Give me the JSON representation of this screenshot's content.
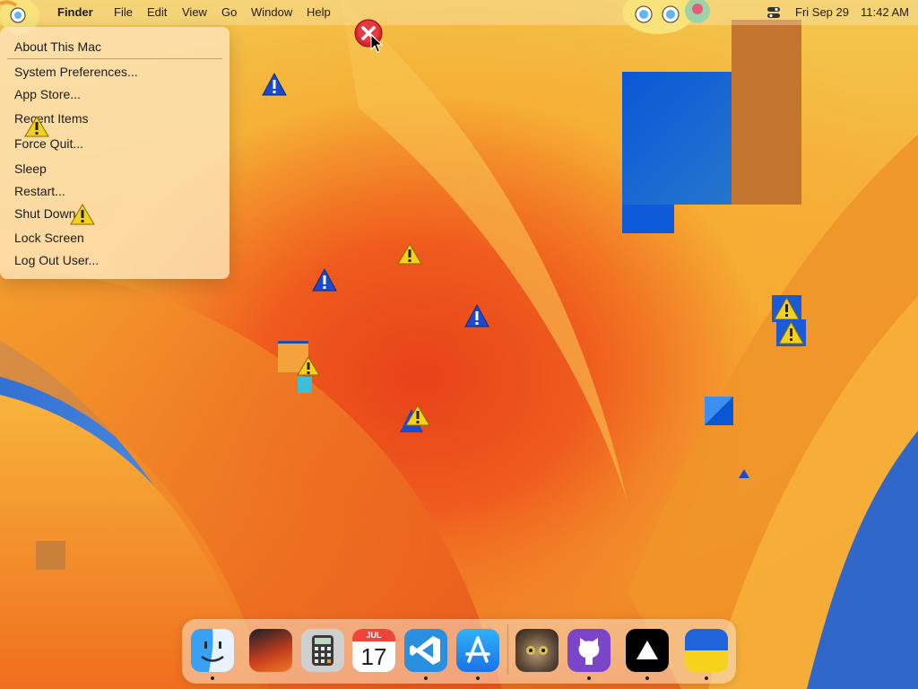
{
  "menubar": {
    "app_name": "Finder",
    "menus": [
      "File",
      "Edit",
      "View",
      "Go",
      "Window",
      "Help"
    ],
    "date": "Fri Sep 29",
    "time": "11:42 AM",
    "control_center_icon": "control-center-icon"
  },
  "apple_menu": {
    "items": [
      "About This Mac",
      "System Preferences...",
      "App Store...",
      "Recent Items",
      "Force Quit...",
      "Sleep",
      "Restart...",
      "Shut Down...",
      "Lock Screen",
      "Log Out User..."
    ]
  },
  "dock": {
    "apps": [
      {
        "icon": "finder-icon",
        "running": true
      },
      {
        "icon": "photos-wallpaper-icon",
        "running": false
      },
      {
        "icon": "calculator-icon",
        "running": false
      },
      {
        "icon": "calendar-icon",
        "running": false,
        "month": "JUL",
        "day": "17"
      },
      {
        "icon": "vscode-icon",
        "running": true
      },
      {
        "icon": "app-store-icon",
        "running": true
      },
      {
        "icon": "cat-photo-icon",
        "running": false
      },
      {
        "icon": "github-icon",
        "running": true
      },
      {
        "icon": "arc-triangle-icon",
        "running": true
      },
      {
        "icon": "ukraine-flag-icon",
        "running": true
      }
    ]
  },
  "colors": {
    "accent_blue": "#1a5ad6",
    "warning_yellow": "#f4d21a",
    "wallpaper_orange": "#f28a25"
  }
}
